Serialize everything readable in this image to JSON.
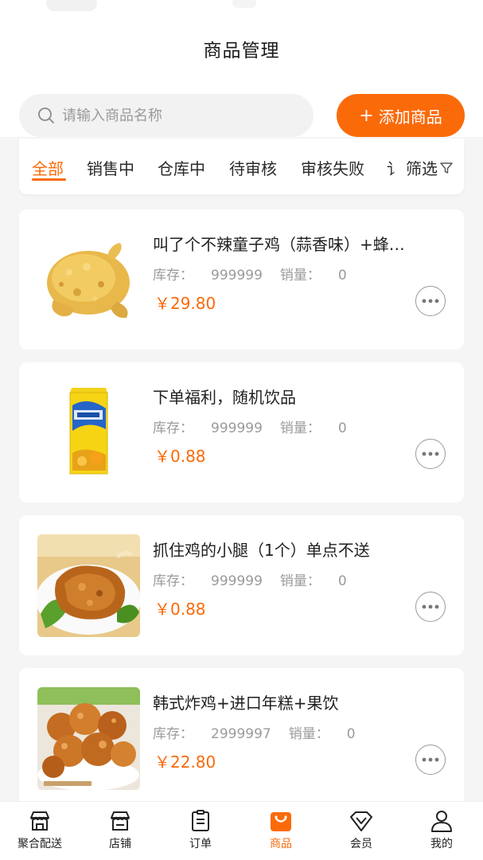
{
  "header": {
    "title": "商品管理"
  },
  "search": {
    "placeholder": "请输入商品名称"
  },
  "add_button": {
    "plus": "+",
    "label": "添加商品"
  },
  "tabs": [
    {
      "label": "全部",
      "active": true
    },
    {
      "label": "销售中"
    },
    {
      "label": "仓库中"
    },
    {
      "label": "待审核"
    },
    {
      "label": "审核失败"
    },
    {
      "label": "讠"
    }
  ],
  "filter": {
    "label": "筛选",
    "icon": "filter-icon"
  },
  "labels": {
    "stock": "库存：",
    "sales": "销量："
  },
  "products": [
    {
      "name": "叫了个不辣童子鸡（蒜香味）+蜂…",
      "stock": "999999",
      "sales": "0",
      "price": "￥29.80",
      "image": "fried-chicken-whole"
    },
    {
      "name": "下单福利，随机饮品",
      "stock": "999999",
      "sales": "0",
      "price": "￥0.88",
      "image": "iced-tea-carton"
    },
    {
      "name": "抓住鸡的小腿（1个）单点不送",
      "stock": "999999",
      "sales": "0",
      "price": "￥0.88",
      "image": "fried-drumstick-plate"
    },
    {
      "name": "韩式炸鸡+进口年糕+果饮",
      "stock": "2999997",
      "sales": "0",
      "price": "￥22.80",
      "image": "korean-fried-chicken"
    }
  ],
  "bottom_nav": [
    {
      "label": "聚合配送",
      "icon": "store-delivery-icon"
    },
    {
      "label": "店铺",
      "icon": "store-icon"
    },
    {
      "label": "订单",
      "icon": "order-clipboard-icon"
    },
    {
      "label": "商品",
      "icon": "shopping-bag-icon",
      "active": true
    },
    {
      "label": "会员",
      "icon": "member-diamond-icon"
    },
    {
      "label": "我的",
      "icon": "profile-icon"
    }
  ],
  "colors": {
    "accent": "#fb6a09",
    "background": "#f5f5f5",
    "muted": "#9b9b9b"
  }
}
